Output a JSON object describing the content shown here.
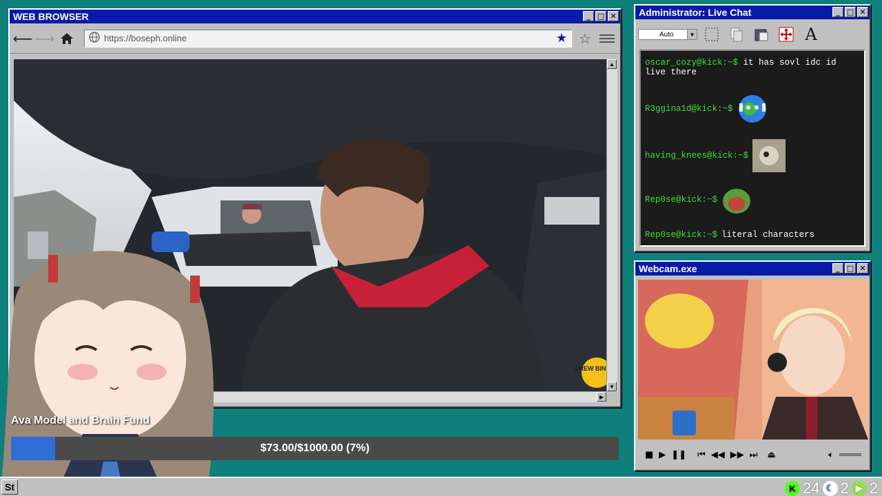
{
  "browser": {
    "title": "WEB BROWSER",
    "url": "https://boseph.online",
    "watermark": "DREW BINSKY"
  },
  "chat": {
    "title": "Administrator: Live Chat",
    "font_size_select": "Auto",
    "messages": [
      {
        "user": "oscar_cozy@kick:~$",
        "text": "it has sovl idc id live there",
        "emote": null
      },
      {
        "user": "R3ggina1d@kick:~$",
        "text": "",
        "emote": "crying-earth-emote"
      },
      {
        "user": "having_knees@kick:~$",
        "text": "",
        "emote": "cat-photo-emote"
      },
      {
        "user": "Rep0se@kick:~$",
        "text": "",
        "emote": "screaming-frog-emote"
      },
      {
        "user": "Rep0se@kick:~$",
        "text": "literal characters",
        "emote": null
      }
    ],
    "colors": {
      "username": "#3ddc3d",
      "background": "#1b1b1b"
    }
  },
  "webcam": {
    "title": "Webcam.exe"
  },
  "donation": {
    "title": "Ava Model and Brain Fund",
    "progress_text": "$73.00/$1000.00 (7%)",
    "raised": 73.0,
    "goal": 1000.0,
    "percent": 7
  },
  "taskbar": {
    "start_label": "St",
    "tray": [
      {
        "icon": "kick-icon",
        "count": "24"
      },
      {
        "icon": "moon-icon",
        "count": "2"
      },
      {
        "icon": "play-icon",
        "count": "2"
      }
    ]
  },
  "theme": {
    "titlebar": "#0a1aa8",
    "desktop": "#0e7f7a",
    "progress": "#2f6dd8"
  }
}
